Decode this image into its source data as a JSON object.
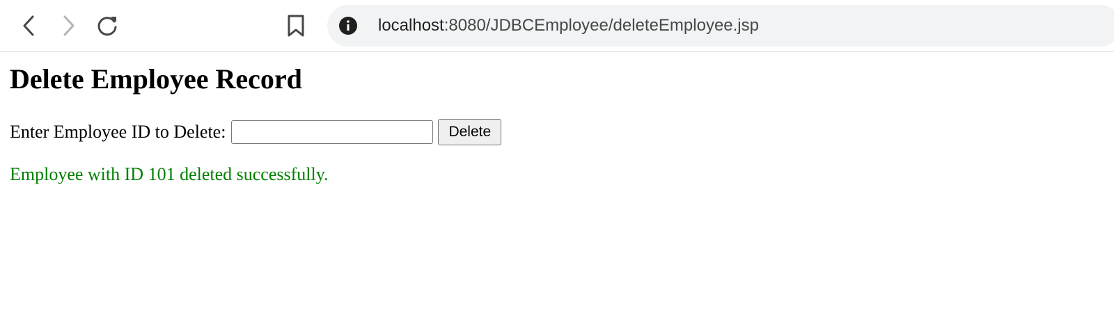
{
  "browser": {
    "url_host": "localhost",
    "url_path": ":8080/JDBCEmployee/deleteEmployee.jsp",
    "icons": {
      "back": "chevron-left-icon",
      "forward": "chevron-right-icon",
      "reload": "reload-icon",
      "bookmark": "bookmark-icon",
      "site_info": "info-icon"
    }
  },
  "page": {
    "heading": "Delete Employee Record",
    "form": {
      "label": "Enter Employee ID to Delete:",
      "input_value": "",
      "button_label": "Delete"
    },
    "message": {
      "text": "Employee with ID 101 deleted successfully.",
      "color": "#008000"
    }
  }
}
